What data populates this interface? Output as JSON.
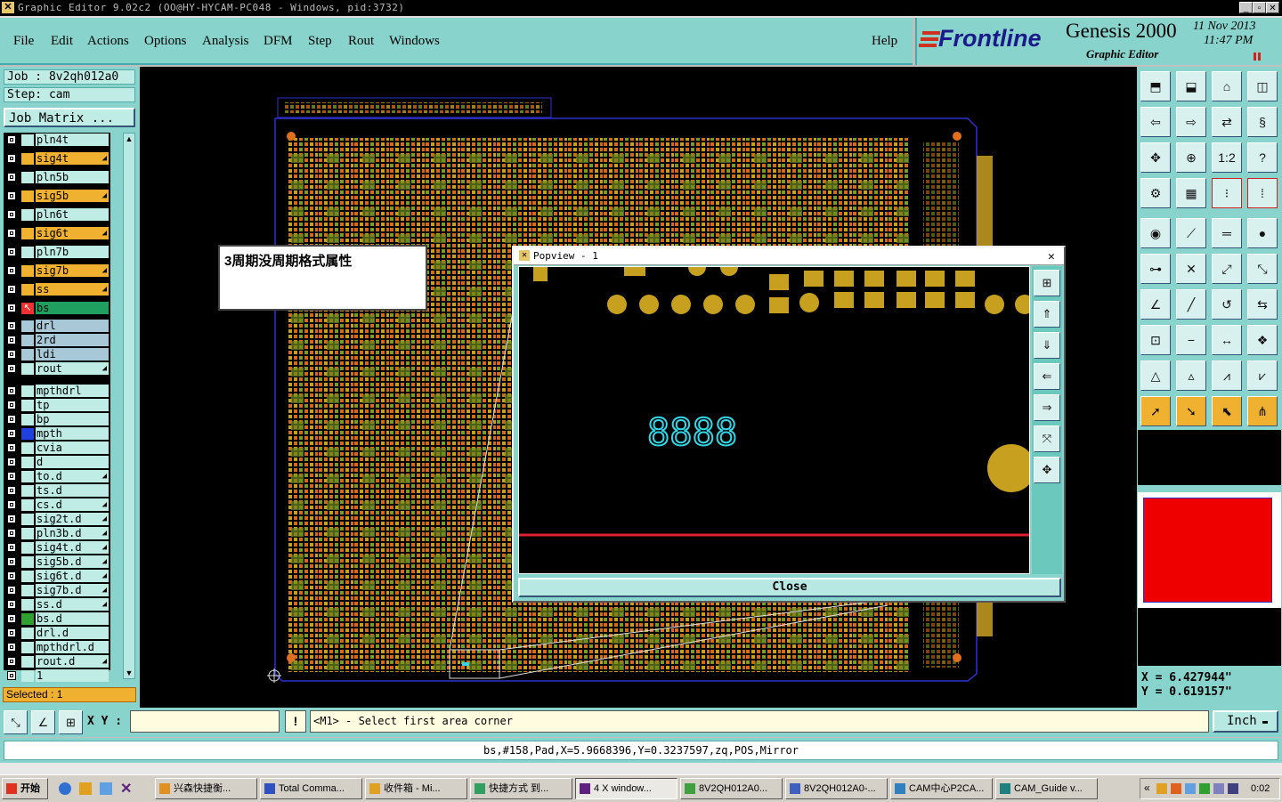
{
  "window": {
    "title": "Graphic Editor 9.02c2 (OO@HY-HYCAM-PC048 - Windows, pid:3732)",
    "minimize": "_",
    "maximize": "▫",
    "close": "✕"
  },
  "menu": {
    "items": [
      "File",
      "Edit",
      "Actions",
      "Options",
      "Analysis",
      "DFM",
      "Step",
      "Rout",
      "Windows"
    ],
    "help": "Help"
  },
  "brand": {
    "logo": "Frontline",
    "product": "Genesis 2000",
    "subtitle": "Graphic Editor",
    "date": "11 Nov 2013",
    "time": "11:47 PM"
  },
  "job": {
    "job_label": "Job : 8v2qh012a0",
    "step_label": "Step: cam",
    "matrix_button": "Job Matrix ..."
  },
  "layers": [
    {
      "name": "pln4t",
      "color": "#c0ece6",
      "box": "#c0ece6",
      "lock": false
    },
    {
      "name": "sig4t",
      "color": "#f0b030",
      "box": "#f0b030",
      "lock": true
    },
    {
      "name": "pln5b",
      "color": "#c0ece6",
      "box": "#c0ece6",
      "lock": false
    },
    {
      "name": "sig5b",
      "color": "#f0b030",
      "box": "#f0b030",
      "lock": true
    },
    {
      "name": "pln6t",
      "color": "#c0ece6",
      "box": "#c0ece6",
      "lock": false
    },
    {
      "name": "sig6t",
      "color": "#f0b030",
      "box": "#f0b030",
      "lock": true
    },
    {
      "name": "pln7b",
      "color": "#c0ece6",
      "box": "#c0ece6",
      "lock": false
    },
    {
      "name": "sig7b",
      "color": "#f0b030",
      "box": "#f0b030",
      "lock": true
    },
    {
      "name": "ss",
      "color": "#f0b030",
      "box": "#f0b030",
      "lock": true
    },
    {
      "name": "bs",
      "color": "#f03030",
      "box": "#20a060",
      "lock": false,
      "active": true
    },
    {
      "name": "drl",
      "color": "#a8c8d8",
      "box": "#a8c8d8",
      "lock": false
    },
    {
      "name": "2rd",
      "color": "#a8c8d8",
      "box": "#a8c8d8",
      "lock": false
    },
    {
      "name": "ldi",
      "color": "#a8c8d8",
      "box": "#a8c8d8",
      "lock": false
    },
    {
      "name": "rout",
      "color": "#c0ece6",
      "box": "#c0ece6",
      "lock": true
    },
    {
      "name": "mpthdrl",
      "color": "#c0ece6",
      "box": "#c0ece6",
      "lock": false
    },
    {
      "name": "tp",
      "color": "#c0ece6",
      "box": "#c0ece6",
      "lock": false
    },
    {
      "name": "bp",
      "color": "#c0ece6",
      "box": "#c0ece6",
      "lock": false
    },
    {
      "name": "mpth",
      "color": "#2040e0",
      "box": "#c0ece6",
      "lock": false
    },
    {
      "name": "cvia",
      "color": "#c0ece6",
      "box": "#c0ece6",
      "lock": false
    },
    {
      "name": "d",
      "color": "#c0ece6",
      "box": "#c0ece6",
      "lock": false
    },
    {
      "name": "to.d",
      "color": "#c0ece6",
      "box": "#c0ece6",
      "lock": true
    },
    {
      "name": "ts.d",
      "color": "#c0ece6",
      "box": "#c0ece6",
      "lock": false
    },
    {
      "name": "cs.d",
      "color": "#c0ece6",
      "box": "#c0ece6",
      "lock": true
    },
    {
      "name": "sig2t.d",
      "color": "#c0ece6",
      "box": "#c0ece6",
      "lock": true
    },
    {
      "name": "pln3b.d",
      "color": "#c0ece6",
      "box": "#c0ece6",
      "lock": true
    },
    {
      "name": "sig4t.d",
      "color": "#c0ece6",
      "box": "#c0ece6",
      "lock": true
    },
    {
      "name": "sig5b.d",
      "color": "#c0ece6",
      "box": "#c0ece6",
      "lock": true
    },
    {
      "name": "sig6t.d",
      "color": "#c0ece6",
      "box": "#c0ece6",
      "lock": true
    },
    {
      "name": "sig7b.d",
      "color": "#c0ece6",
      "box": "#c0ece6",
      "lock": true
    },
    {
      "name": "ss.d",
      "color": "#c0ece6",
      "box": "#c0ece6",
      "lock": true
    },
    {
      "name": "bs.d",
      "color": "#30a030",
      "box": "#c0ece6",
      "lock": false
    },
    {
      "name": "drl.d",
      "color": "#c0ece6",
      "box": "#c0ece6",
      "lock": false
    },
    {
      "name": "mpthdrl.d",
      "color": "#c0ece6",
      "box": "#c0ece6",
      "lock": false
    },
    {
      "name": "rout.d",
      "color": "#c0ece6",
      "box": "#c0ece6",
      "lock": true
    },
    {
      "name": "1",
      "color": "#c0ece6",
      "box": "#c0ece6",
      "lock": false
    }
  ],
  "selected_label": "Selected : 1",
  "note_popup": {
    "text": "3周期没周期格式属性"
  },
  "popview": {
    "title": "Popview - 1",
    "digits": "8888",
    "close_button": "Close"
  },
  "coords": {
    "x": "X = 6.427944\"",
    "y": "Y = 0.619157\""
  },
  "command": {
    "xy_label": "X Y :",
    "xy_value": "",
    "prompt": "<M1> - Select first area corner",
    "unit": "Inch",
    "excl": "!"
  },
  "status_line": "bs,#158,Pad,X=5.9668396,Y=0.3237597,zq,POS,Mirror",
  "taskbar": {
    "start": "开始",
    "tasks": [
      "兴森快捷衡...",
      "Total Comma...",
      "收件箱 - Mi...",
      "快捷方式 到...",
      "4 X window...",
      "8V2QH012A0...",
      "8V2QH012A0-...",
      "CAM中心P2CA...",
      "CAM_Guide v..."
    ],
    "clock": "0:02"
  },
  "colors": {
    "panel": "#88d4cc",
    "canvas": "#000000",
    "pad_orange": "#d46a1e",
    "pad_gold": "#c8a020",
    "pad_green": "#7a9a2a",
    "outline": "#3030d0",
    "red_line": "#e02030",
    "cyan": "#30d8e8"
  }
}
